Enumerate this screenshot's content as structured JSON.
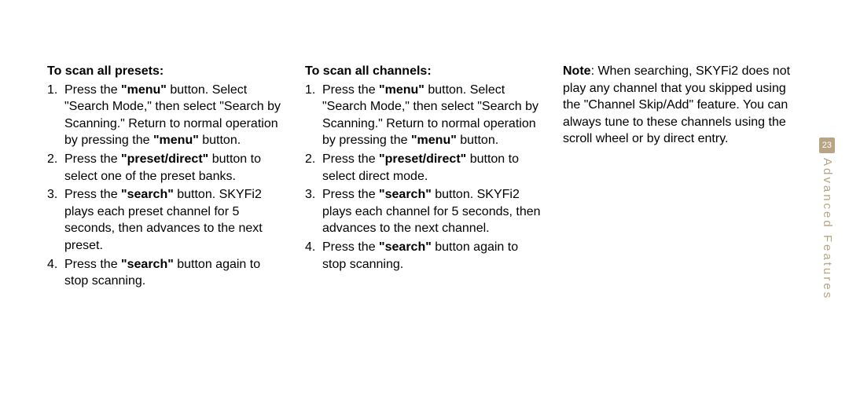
{
  "col1": {
    "heading": "To scan all presets:",
    "steps": [
      {
        "pre": "Press the ",
        "b1": "\"menu\"",
        "mid1": " button. Select \"Search Mode,\" then select \"Search by Scanning.\" Return to normal operation by pressing the ",
        "b2": "\"menu\"",
        "mid2": " button."
      },
      {
        "pre": "Press the ",
        "b1": "\"preset/direct\"",
        "mid1": " button to select one of the preset banks.",
        "b2": "",
        "mid2": ""
      },
      {
        "pre": "Press the ",
        "b1": "\"search\"",
        "mid1": " button. SKYFi2 plays each preset channel for 5 seconds, then advances to the next preset.",
        "b2": "",
        "mid2": ""
      },
      {
        "pre": "Press the ",
        "b1": "\"search\"",
        "mid1": " button again to stop scanning.",
        "b2": "",
        "mid2": ""
      }
    ]
  },
  "col2": {
    "heading": "To scan all channels:",
    "steps": [
      {
        "pre": "Press the ",
        "b1": "\"menu\"",
        "mid1": " button. Select \"Search Mode,\" then select \"Search by Scanning.\" Return to normal operation by pressing the ",
        "b2": "\"menu\"",
        "mid2": " button."
      },
      {
        "pre": "Press the ",
        "b1": "\"preset/direct\"",
        "mid1": " button to select direct mode.",
        "b2": "",
        "mid2": ""
      },
      {
        "pre": "Press the ",
        "b1": "\"search\"",
        "mid1": " button. SKYFi2 plays each channel for 5 seconds, then advances to the next channel.",
        "b2": "",
        "mid2": ""
      },
      {
        "pre": "Press the ",
        "b1": "\"search\"",
        "mid1": " button again to stop scanning.",
        "b2": "",
        "mid2": ""
      }
    ]
  },
  "note": {
    "label": "Note",
    "text": ": When searching, SKYFi2 does not play any channel that you skipped using the \"Channel Skip/Add\" feature. You can always tune to these channels using the scroll wheel or by direct entry."
  },
  "sidebar": {
    "page": "23",
    "label": "Advanced Features"
  }
}
